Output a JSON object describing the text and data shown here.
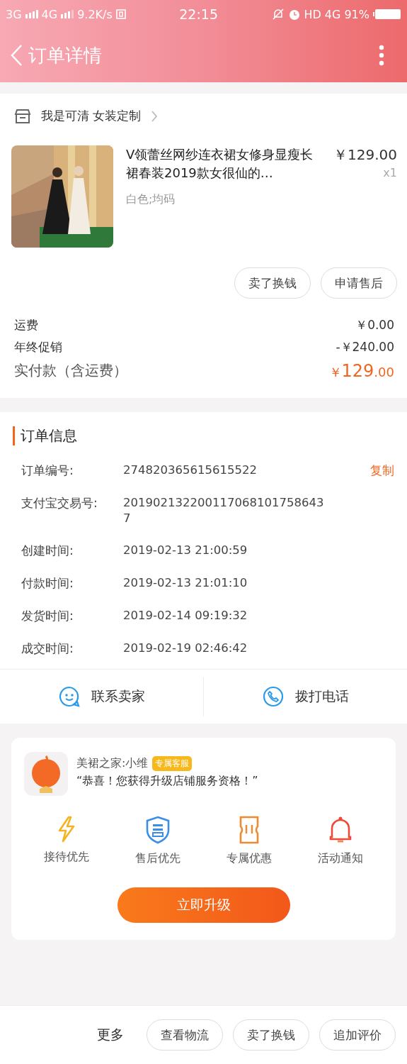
{
  "status_bar": {
    "left": [
      "3G",
      "4G",
      "9.2K/s"
    ],
    "time": "22:15",
    "network": "HD",
    "network_type": "4G",
    "battery": "91%"
  },
  "header": {
    "title": "订单详情"
  },
  "shop": {
    "name": "我是可清 女装定制"
  },
  "product": {
    "kind": "picture",
    "title": "V领蕾丝网纱连衣裙女修身显瘦长裙春装2019款女很仙的…",
    "spec": "白色;均码",
    "price": "￥129.00",
    "quantity": "x1",
    "actions": [
      "卖了换钱",
      "申请售后"
    ]
  },
  "costs": [
    {
      "label": "运费",
      "value": "￥0.00"
    },
    {
      "label": "年终促销",
      "value": "-￥240.00"
    }
  ],
  "total": {
    "label": "实付款（含运费）",
    "currency": "￥",
    "amount": "129",
    "decimals": ".00"
  },
  "order_info": {
    "title": "订单信息",
    "copy": "复制",
    "rows": [
      {
        "label": "订单编号:",
        "value": "274820365615615522"
      },
      {
        "label": "支付宝交易号:",
        "value": "2019021322001170681017586437"
      },
      {
        "label": "创建时间:",
        "value": "2019-02-13 21:00:59"
      },
      {
        "label": "付款时间:",
        "value": "2019-02-13 21:01:10"
      },
      {
        "label": "发货时间:",
        "value": "2019-02-14 09:19:32"
      },
      {
        "label": "成交时间:",
        "value": "2019-02-19 02:46:42"
      }
    ]
  },
  "contact": [
    {
      "kind": "chat",
      "label": "联系卖家"
    },
    {
      "kind": "phone",
      "label": "拨打电话"
    }
  ],
  "upgrade": {
    "agent": "美裙之家:小维",
    "badge": "专属客服",
    "message": "“恭喜！您获得升级店铺服务资格！”",
    "perks": [
      {
        "kind": "bolt",
        "label": "接待优先"
      },
      {
        "kind": "shield",
        "label": "售后优先"
      },
      {
        "kind": "ticket",
        "label": "专属优惠"
      },
      {
        "kind": "bell",
        "label": "活动通知"
      }
    ],
    "button": "立即升级"
  },
  "bottom_bar": {
    "more": "更多",
    "buttons": [
      "查看物流",
      "卖了换钱",
      "追加评价"
    ]
  }
}
